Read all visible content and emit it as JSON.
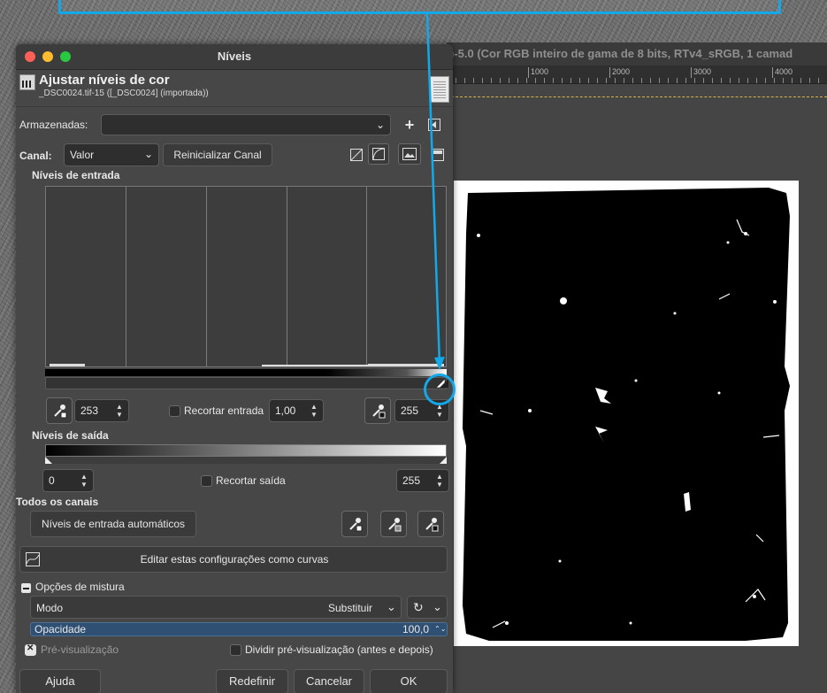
{
  "canvas": {
    "title": ")-5.0 (Cor RGB inteiro de gama de 8 bits, RTv4_sRGB, 1 camad",
    "ruler_ticks": [
      "1000",
      "2000",
      "3000",
      "4000"
    ]
  },
  "dialog": {
    "title": "Níveis",
    "header_title": "Ajustar níveis de cor",
    "header_subtitle": "_DSC0024.tif-15 ([_DSC0024] (importada))",
    "presets_label": "Armazenadas:",
    "presets_value": "",
    "channel_label": "Canal:",
    "channel_value": "Valor",
    "reset_channel": "Reinicializar Canal",
    "input_levels_label": "Níveis de entrada",
    "input_low": "253",
    "clip_input_label": "Recortar entrada",
    "gamma": "1,00",
    "input_high": "255",
    "output_levels_label": "Níveis de saída",
    "output_low": "0",
    "clip_output_label": "Recortar saída",
    "output_high": "255",
    "all_channels_label": "Todos os canais",
    "auto_input_levels": "Níveis de entrada automáticos",
    "edit_as_curves": "Editar estas configurações como curvas",
    "blend_options_label": "Opções de mistura",
    "mode_label": "Modo",
    "mode_value": "Substituir",
    "opacity_label": "Opacidade",
    "opacity_value": "100,0",
    "preview_label": "Pré-visualização",
    "split_preview_label": "Dividir pré-visualização (antes e depois)",
    "help_button": "Ajuda",
    "reset_button": "Redefinir",
    "cancel_button": "Cancelar",
    "ok_button": "OK"
  },
  "colors": {
    "annotation": "#13a9e8",
    "dialog_bg": "#474747",
    "opacity_fill": "#2f5072"
  }
}
